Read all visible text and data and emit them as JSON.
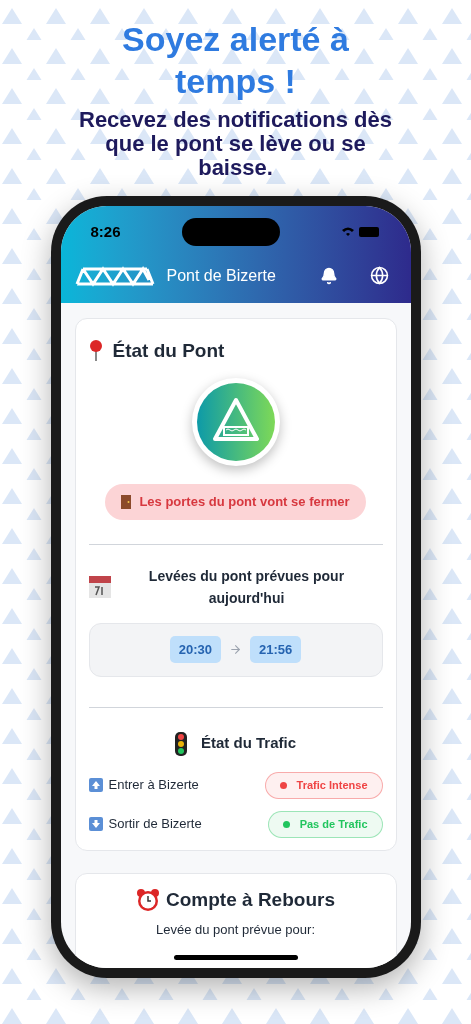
{
  "headline": "Soyez alerté à temps !",
  "subheadline": "Recevez des notifications dès que le pont se lève ou se baisse.",
  "status_bar": {
    "time": "8:26"
  },
  "app_bar": {
    "title": "Pont de Bizerte"
  },
  "bridge_card": {
    "title": "État du Pont",
    "status": "Les portes du pont vont se fermer",
    "schedule_title": "Levées du pont prévues pour aujourd'hui",
    "schedule": [
      {
        "start": "20:30",
        "end": "21:56"
      }
    ],
    "traffic_title": "État du Trafic",
    "traffic": [
      {
        "kind": "up",
        "label": "Entrer à Bizerte",
        "status": "Trafic Intense",
        "color": "#ef4444"
      },
      {
        "kind": "down",
        "label": "Sortir de Bizerte",
        "status": "Pas de Trafic",
        "color": "#22c55e"
      }
    ]
  },
  "countdown_card": {
    "title": "Compte à Rebours",
    "subtitle": "Levée du pont prévue pour:"
  }
}
